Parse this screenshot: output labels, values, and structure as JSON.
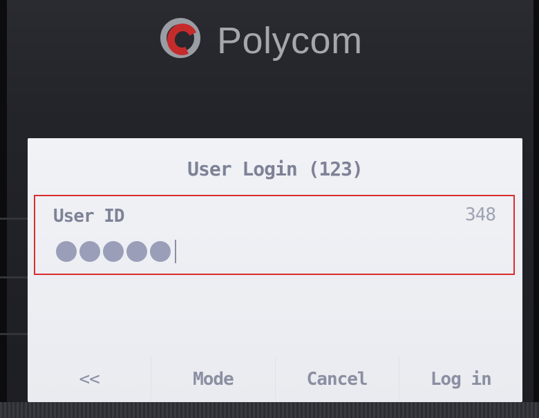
{
  "brand": {
    "name": "Polycom",
    "logo_icon": "polycom-logo-icon",
    "colors": {
      "logo_red": "#c62b2b",
      "logo_gray": "#9a9da3"
    }
  },
  "screen": {
    "title": "User Login (123)",
    "field": {
      "label": "User ID",
      "count": "348",
      "masked_value": "●●●●●",
      "highlight_color": "#d92c2c"
    },
    "softkeys": [
      {
        "label": "<<"
      },
      {
        "label": "Mode"
      },
      {
        "label": "Cancel"
      },
      {
        "label": "Log in"
      }
    ]
  }
}
